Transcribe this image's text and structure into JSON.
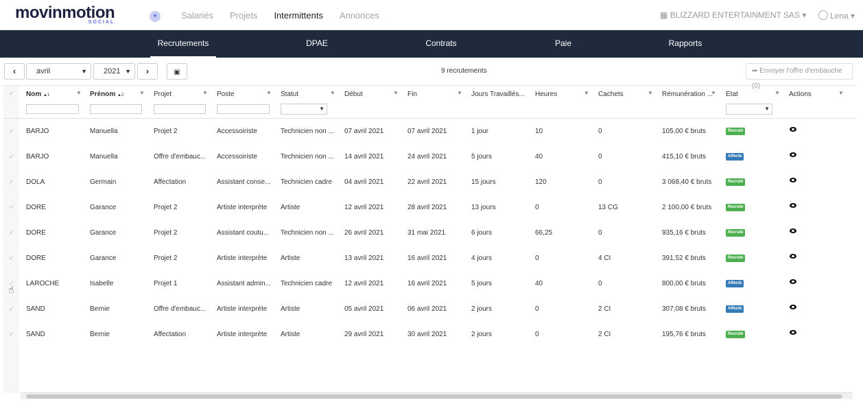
{
  "brand": {
    "name_main": "movinmotion",
    "name_sub": "SOCIAL"
  },
  "topnav": {
    "items": [
      "Salariés",
      "Projets",
      "Intermittents",
      "Annonces"
    ],
    "active": "Intermittents"
  },
  "company": {
    "name": "BLIZZARD ENTERTAINMENT SAS",
    "chevron": "▾"
  },
  "user": {
    "name": "Lena",
    "chevron": "▾"
  },
  "subnav": {
    "tabs": [
      "Recrutements",
      "DPAE",
      "Contrats",
      "Paie",
      "Rapports"
    ],
    "active": "Recrutements"
  },
  "toolbar": {
    "prev": "‹",
    "next": "›",
    "month": "avril",
    "year": "2021",
    "calendar_icon": "calendar-icon",
    "count_label": "9 recrutements",
    "send_label": "Envoyer l'offre d'embauche (0)"
  },
  "columns": {
    "nom": "Nom",
    "nom_sort": "▲1",
    "prenom": "Prénom",
    "prenom_sort": "▲2",
    "projet": "Projet",
    "poste": "Poste",
    "statut": "Statut",
    "debut": "Début",
    "fin": "Fin",
    "jours": "Jours Travaillés...",
    "heures": "Heures",
    "cachets": "Cachets",
    "remu": "Rémunération ...",
    "etat": "Etat",
    "actions": "Actions"
  },
  "colors": {
    "recrute": "#4caf50",
    "affecte": "#337ab7",
    "dark_nav": "#1f2a3c",
    "brand": "#5b6ee1"
  },
  "rows": [
    {
      "nom": "BARJO",
      "prenom": "Manuella",
      "projet": "Projet 2",
      "poste": "Accessoiriste",
      "statut": "Technicien non ...",
      "debut": "07 avril 2021",
      "fin": "07 avril 2021",
      "jours": "1 jour",
      "heures": "10",
      "cachets": "0",
      "remu": "105,00 € bruts",
      "etat": "Recruté",
      "etat_kind": "recrute"
    },
    {
      "nom": "BARJO",
      "prenom": "Manuella",
      "projet": "Offre d'embauc...",
      "poste": "Accessoiriste",
      "statut": "Technicien non ...",
      "debut": "14 avril 2021",
      "fin": "24 avril 2021",
      "jours": "5 jours",
      "heures": "40",
      "cachets": "0",
      "remu": "415,10 € bruts",
      "etat": "Affecté",
      "etat_kind": "affecte"
    },
    {
      "nom": "DOLA",
      "prenom": "Germain",
      "projet": "Affectation",
      "poste": "Assistant conse...",
      "statut": "Technicien cadre",
      "debut": "04 avril 2021",
      "fin": "22 avril 2021",
      "jours": "15 jours",
      "heures": "120",
      "cachets": "0",
      "remu": "3 068,40 € bruts",
      "etat": "Recruté",
      "etat_kind": "recrute"
    },
    {
      "nom": "DORE",
      "prenom": "Garance",
      "projet": "Projet 2",
      "poste": "Artiste interprète",
      "statut": "Artiste",
      "debut": "12 avril 2021",
      "fin": "28 avril 2021",
      "jours": "13 jours",
      "heures": "0",
      "cachets": "13 CG",
      "remu": "2 100,00 € bruts",
      "etat": "Recruté",
      "etat_kind": "recrute"
    },
    {
      "nom": "DORE",
      "prenom": "Garance",
      "projet": "Projet 2",
      "poste": "Assistant coutu...",
      "statut": "Technicien non ...",
      "debut": "26 avril 2021",
      "fin": "31 mai 2021",
      "jours": "6 jours",
      "heures": "66,25",
      "cachets": "0",
      "remu": "935,16 € bruts",
      "etat": "Recruté",
      "etat_kind": "recrute"
    },
    {
      "nom": "DORE",
      "prenom": "Garance",
      "projet": "Projet 2",
      "poste": "Artiste interprète",
      "statut": "Artiste",
      "debut": "13 avril 2021",
      "fin": "16 avril 2021",
      "jours": "4 jours",
      "heures": "0",
      "cachets": "4 CI",
      "remu": "391,52 € bruts",
      "etat": "Recruté",
      "etat_kind": "recrute"
    },
    {
      "nom": "LAROCHE",
      "prenom": "Isabelle",
      "projet": "Projet 1",
      "poste": "Assistant admin...",
      "statut": "Technicien cadre",
      "debut": "12 avril 2021",
      "fin": "16 avril 2021",
      "jours": "5 jours",
      "heures": "40",
      "cachets": "0",
      "remu": "800,00 € bruts",
      "etat": "Affecté",
      "etat_kind": "affecte"
    },
    {
      "nom": "SAND",
      "prenom": "Bernie",
      "projet": "Offre d'embauc...",
      "poste": "Artiste interprète",
      "statut": "Artiste",
      "debut": "05 avril 2021",
      "fin": "06 avril 2021",
      "jours": "2 jours",
      "heures": "0",
      "cachets": "2 CI",
      "remu": "307,08 € bruts",
      "etat": "Affecté",
      "etat_kind": "affecte"
    },
    {
      "nom": "SAND",
      "prenom": "Bernie",
      "projet": "Affectation",
      "poste": "Artiste interprète",
      "statut": "Artiste",
      "debut": "29 avril 2021",
      "fin": "30 avril 2021",
      "jours": "2 jours",
      "heures": "0",
      "cachets": "2 CI",
      "remu": "195,76 € bruts",
      "etat": "Recruté",
      "etat_kind": "recrute"
    }
  ]
}
